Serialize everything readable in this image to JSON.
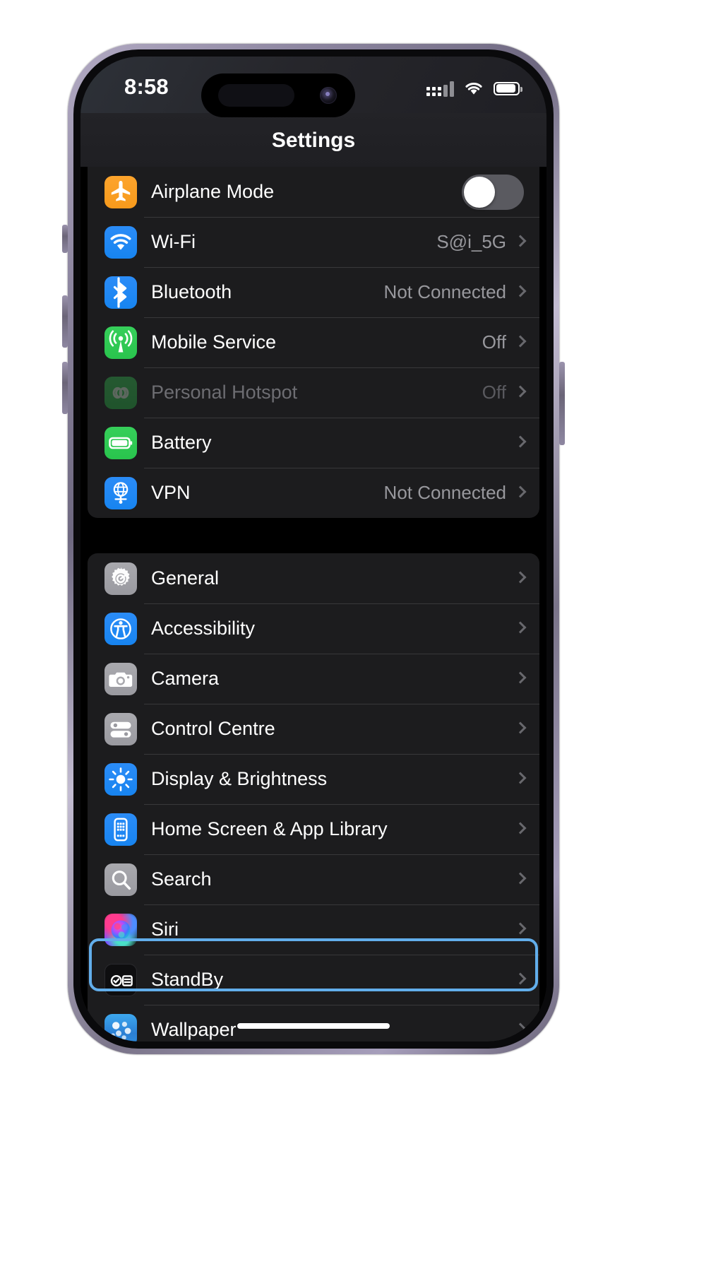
{
  "device": {
    "frame_color": "#8d86a0",
    "screen_bg": "#000000"
  },
  "statusbar": {
    "time": "8:58",
    "cellular_icon": "cellular-bars-icon",
    "wifi_icon": "wifi-icon",
    "battery_icon": "battery-icon",
    "battery_level_percent": 84
  },
  "navbar": {
    "title": "Settings"
  },
  "theme": {
    "accent_blue": "#2b8cf7",
    "group_bg": "#1c1c1e",
    "separator": "#38383a",
    "value_text": "#98989d",
    "highlight_border": "#62aeeb"
  },
  "groups": [
    {
      "name": "connectivity",
      "rows": [
        {
          "label": "Airplane Mode",
          "icon": "airplane-icon",
          "icon_color": "#fda42c",
          "control": "toggle",
          "toggle_on": false
        },
        {
          "label": "Wi-Fi",
          "icon": "wifi-icon",
          "icon_color": "#2b8cf7",
          "value": "S@i_5G",
          "control": "chevron"
        },
        {
          "label": "Bluetooth",
          "icon": "bluetooth-icon",
          "icon_color": "#2b8cf7",
          "value": "Not Connected",
          "control": "chevron"
        },
        {
          "label": "Mobile Service",
          "icon": "cellular-antenna-icon",
          "icon_color": "#36cf5a",
          "value": "Off",
          "control": "chevron"
        },
        {
          "label": "Personal Hotspot",
          "icon": "hotspot-link-icon",
          "icon_color": "#36cf5a",
          "value": "Off",
          "control": "chevron",
          "disabled": true
        },
        {
          "label": "Battery",
          "icon": "battery-icon",
          "icon_color": "#36cf5a",
          "value": "",
          "control": "chevron"
        },
        {
          "label": "VPN",
          "icon": "vpn-globe-icon",
          "icon_color": "#2b8cf7",
          "value": "Not Connected",
          "control": "chevron"
        }
      ]
    },
    {
      "name": "system",
      "rows": [
        {
          "label": "General",
          "icon": "gear-icon",
          "icon_color": "#a9a9ae",
          "control": "chevron",
          "selected": true
        },
        {
          "label": "Accessibility",
          "icon": "accessibility-icon",
          "icon_color": "#2b8cf7",
          "control": "chevron"
        },
        {
          "label": "Camera",
          "icon": "camera-icon",
          "icon_color": "#a9a9ae",
          "control": "chevron"
        },
        {
          "label": "Control Centre",
          "icon": "sliders-icon",
          "icon_color": "#a9a9ae",
          "control": "chevron"
        },
        {
          "label": "Display & Brightness",
          "icon": "brightness-sun-icon",
          "icon_color": "#2b8cf7",
          "control": "chevron"
        },
        {
          "label": "Home Screen & App Library",
          "icon": "home-screen-icon",
          "icon_color": "#2b8cf7",
          "control": "chevron"
        },
        {
          "label": "Search",
          "icon": "search-icon",
          "icon_color": "#a9a9ae",
          "control": "chevron"
        },
        {
          "label": "Siri",
          "icon": "siri-orb-icon",
          "icon_color": "#151517",
          "control": "chevron"
        },
        {
          "label": "StandBy",
          "icon": "standby-icon",
          "icon_color": "#0e0e10",
          "control": "chevron"
        },
        {
          "label": "Wallpaper",
          "icon": "wallpaper-icon",
          "icon_color": "#3da8ef",
          "control": "chevron"
        }
      ]
    }
  ],
  "home_indicator": {
    "visible": true
  }
}
